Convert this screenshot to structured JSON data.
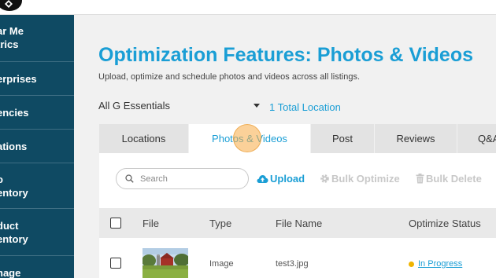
{
  "sidebar": {
    "items": [
      {
        "label": "ar Me\ntrics"
      },
      {
        "label": "erprises"
      },
      {
        "label": "encies"
      },
      {
        "label": "ations"
      },
      {
        "label": "o\nentory"
      },
      {
        "label": "duct\nentory"
      },
      {
        "label": "nage"
      }
    ]
  },
  "header": {
    "title_bold": "Optimization Features:",
    "title_rest": " Photos & Videos",
    "subtitle": "Upload, optimize and schedule photos and videos across all listings."
  },
  "filter": {
    "selected": "All G Essentials",
    "location_count": "1 Total Location"
  },
  "tabs": [
    {
      "label": "Locations"
    },
    {
      "label": "Photos & Videos"
    },
    {
      "label": "Post"
    },
    {
      "label": "Reviews"
    },
    {
      "label": "Q&A"
    }
  ],
  "toolbar": {
    "search_placeholder": "Search",
    "upload_label": "Upload",
    "bulk_optimize_label": "Bulk Optimize",
    "bulk_delete_label": "Bulk Delete"
  },
  "table": {
    "headers": [
      "File",
      "Type",
      "File Name",
      "Optimize Status"
    ],
    "rows": [
      {
        "type": "Image",
        "file_name": "test3.jpg",
        "status": "In Progress"
      }
    ]
  },
  "colors": {
    "accent": "#1a9ed5",
    "sidebar": "#0f4a63",
    "status_in_progress": "#f0b400"
  }
}
